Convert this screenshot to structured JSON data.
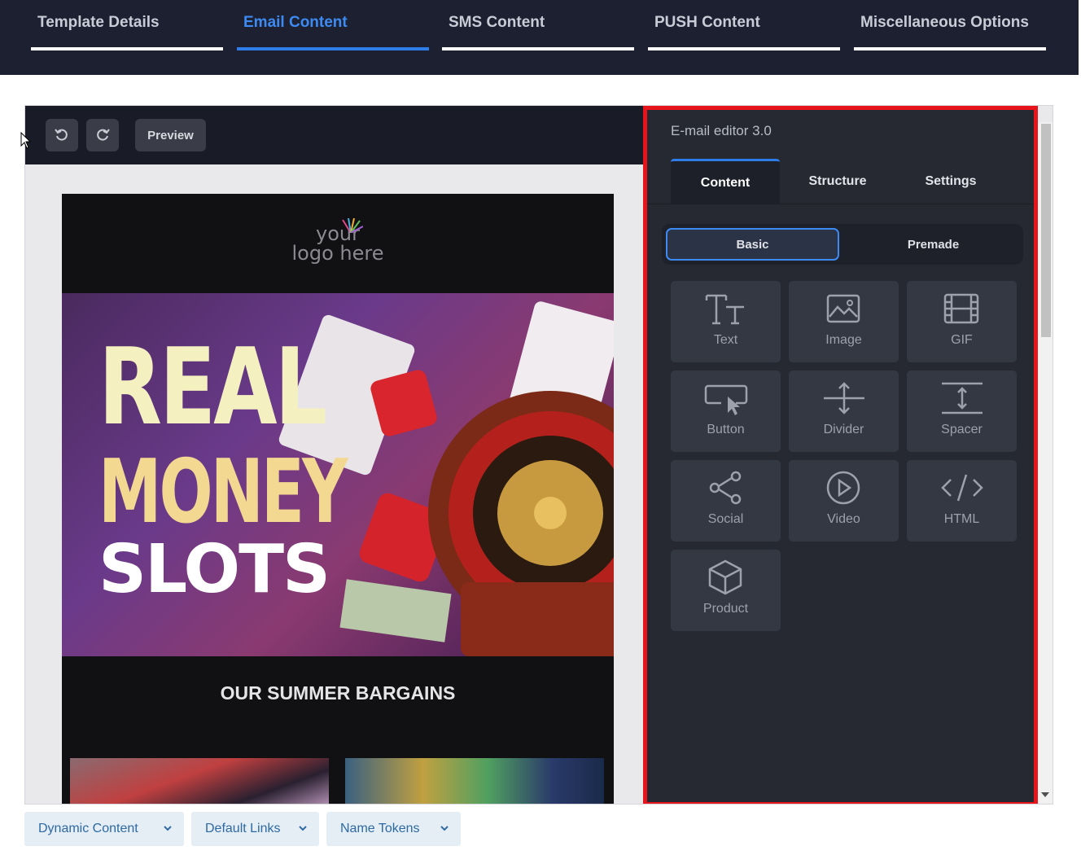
{
  "top_tabs": [
    {
      "label": "Template Details"
    },
    {
      "label": "Email Content"
    },
    {
      "label": "SMS Content"
    },
    {
      "label": "PUSH Content"
    },
    {
      "label": "Miscellaneous Options"
    }
  ],
  "active_tab": "Email Content",
  "toolbar": {
    "preview_label": "Preview",
    "undo_icon": "undo-icon",
    "redo_icon": "redo-icon"
  },
  "email": {
    "logo_text_line1": "your",
    "logo_text_line2": "logo here",
    "hero_line1": "REAL",
    "hero_line2": "MONEY",
    "hero_line3": "SLOTS",
    "section_heading": "OUR SUMMER BARGAINS"
  },
  "panel": {
    "title": "E-mail editor 3.0",
    "tabs": [
      {
        "label": "Content"
      },
      {
        "label": "Structure"
      },
      {
        "label": "Settings"
      }
    ],
    "segment": [
      {
        "label": "Basic"
      },
      {
        "label": "Premade"
      }
    ],
    "blocks": [
      {
        "label": "Text",
        "icon": "text-icon"
      },
      {
        "label": "Image",
        "icon": "image-icon"
      },
      {
        "label": "GIF",
        "icon": "gif-icon"
      },
      {
        "label": "Button",
        "icon": "button-icon"
      },
      {
        "label": "Divider",
        "icon": "divider-icon"
      },
      {
        "label": "Spacer",
        "icon": "spacer-icon"
      },
      {
        "label": "Social",
        "icon": "social-icon"
      },
      {
        "label": "Video",
        "icon": "video-icon"
      },
      {
        "label": "HTML",
        "icon": "html-icon"
      },
      {
        "label": "Product",
        "icon": "product-icon"
      }
    ]
  },
  "bottom_buttons": [
    {
      "label": "Dynamic Content"
    },
    {
      "label": "Default Links"
    },
    {
      "label": "Name Tokens"
    }
  ],
  "colors": {
    "accent": "#2f7de8",
    "highlight_border": "#e8141b",
    "panel_bg": "#262932"
  }
}
